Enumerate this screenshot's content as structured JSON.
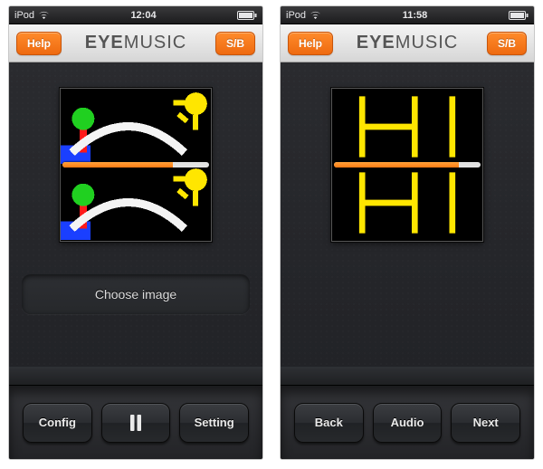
{
  "left": {
    "statusbar": {
      "carrier": "iPod",
      "time": "12:04"
    },
    "navbar": {
      "help": "Help",
      "title_a": "EYE",
      "title_b": "MUSIC",
      "sb": "S/B"
    },
    "preview": {
      "progress_percent": 75
    },
    "choose_label": "Choose image",
    "bottom": {
      "config": "Config",
      "setting": "Setting"
    }
  },
  "right": {
    "statusbar": {
      "carrier": "iPod",
      "time": "11:58"
    },
    "navbar": {
      "help": "Help",
      "title_a": "EYE",
      "title_b": "MUSIC",
      "sb": "S/B"
    },
    "preview": {
      "progress_percent": 85,
      "text": "HI"
    },
    "bottom": {
      "back": "Back",
      "audio": "Audio",
      "next": "Next"
    }
  }
}
